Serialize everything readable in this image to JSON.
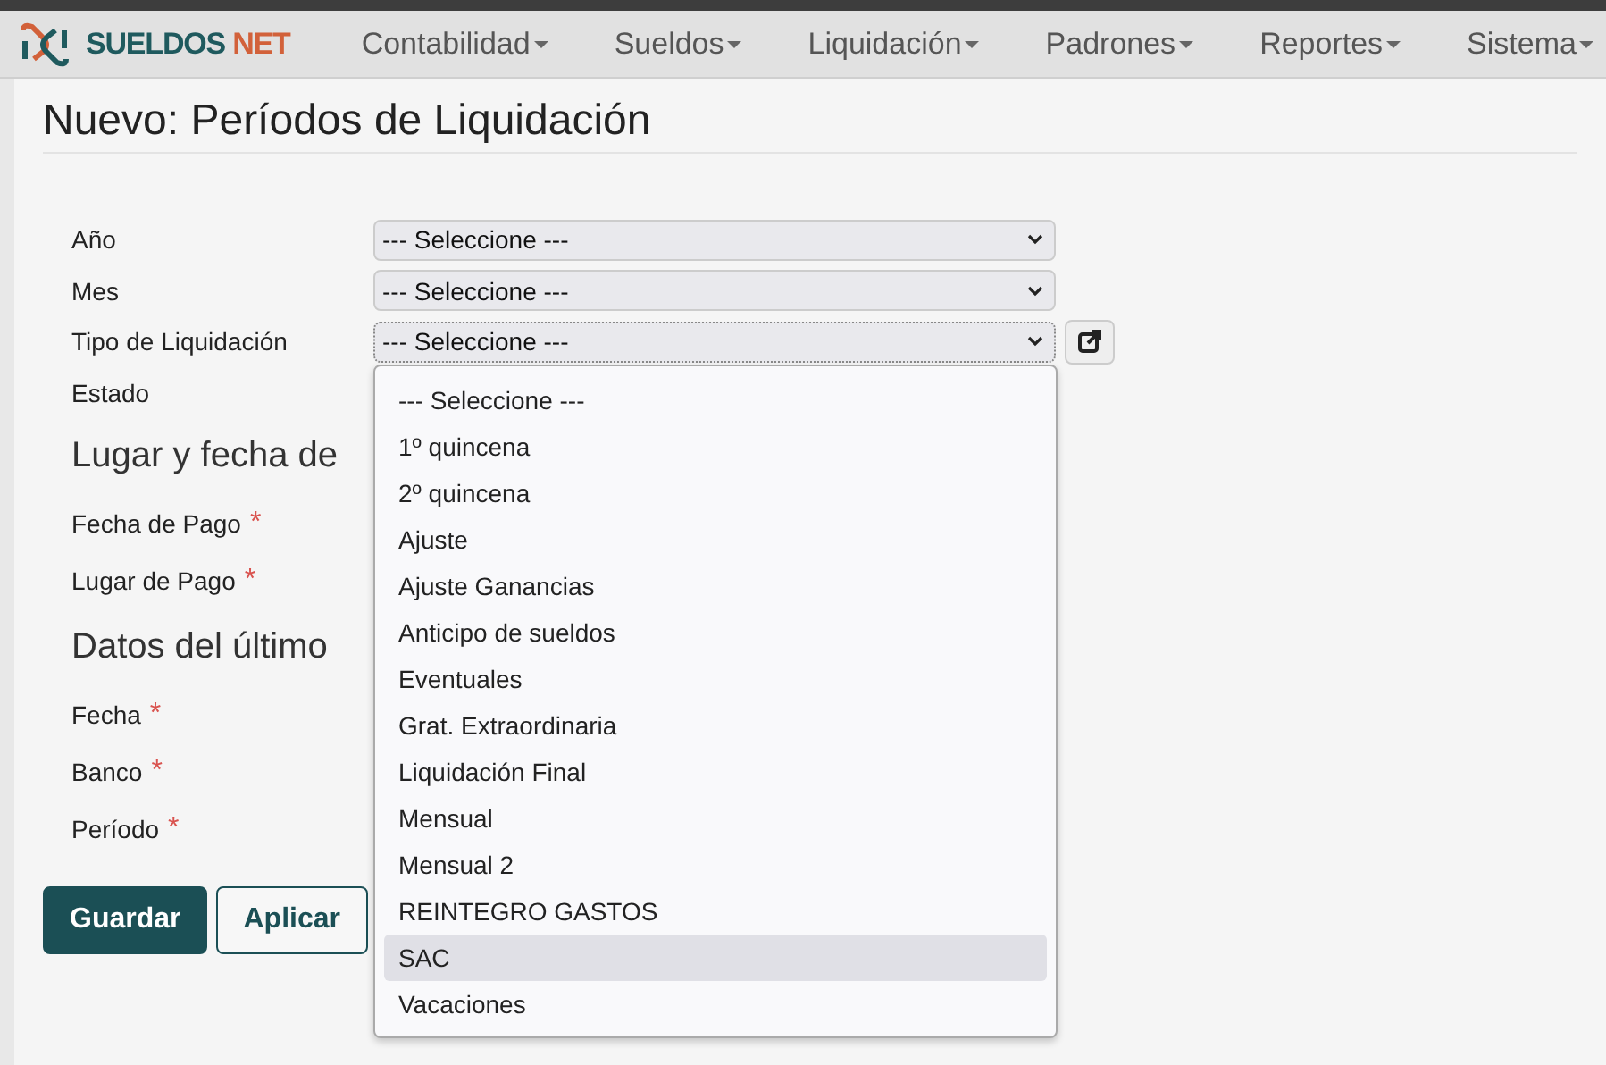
{
  "brand": {
    "name": "SUELDOS",
    "suffix": "NET"
  },
  "menu": [
    {
      "label": "Contabilidad"
    },
    {
      "label": "Sueldos"
    },
    {
      "label": "Liquidación"
    },
    {
      "label": "Padrones"
    },
    {
      "label": "Reportes"
    },
    {
      "label": "Sistema"
    }
  ],
  "title": "Nuevo: Períodos de Liquidación",
  "fields": [
    {
      "label": "Año",
      "kind": "select",
      "value": "--- Seleccione ---"
    },
    {
      "label": "Mes",
      "kind": "select",
      "value": "--- Seleccione ---"
    },
    {
      "label": "Tipo de Liquidación",
      "kind": "select-open",
      "value": "--- Seleccione ---"
    },
    {
      "label": "Estado",
      "kind": "hidden"
    }
  ],
  "sections": [
    {
      "heading": "Lugar y fecha de",
      "fields": [
        {
          "label": "Fecha de Pago",
          "required_mark": "*"
        },
        {
          "label": "Lugar de Pago",
          "required_mark": "*"
        }
      ]
    },
    {
      "heading": "Datos del último",
      "fields": [
        {
          "label": "Fecha",
          "required_mark": "*"
        },
        {
          "label": "Banco",
          "required_mark": "*"
        },
        {
          "label": "Período",
          "required_mark": "*"
        }
      ]
    }
  ],
  "dropdown": {
    "options": [
      {
        "label": "--- Seleccione ---",
        "selected": false
      },
      {
        "label": "1º quincena",
        "selected": false
      },
      {
        "label": "2º quincena",
        "selected": false
      },
      {
        "label": "Ajuste",
        "selected": false
      },
      {
        "label": "Ajuste Ganancias",
        "selected": false
      },
      {
        "label": "Anticipo de sueldos",
        "selected": false
      },
      {
        "label": "Eventuales",
        "selected": false
      },
      {
        "label": "Grat. Extraordinaria",
        "selected": false
      },
      {
        "label": "Liquidación Final",
        "selected": false
      },
      {
        "label": "Mensual",
        "selected": false
      },
      {
        "label": "Mensual 2",
        "selected": false
      },
      {
        "label": "REINTEGRO GASTOS",
        "selected": false
      },
      {
        "label": "SAC",
        "selected": true
      },
      {
        "label": "Vacaciones",
        "selected": false
      }
    ]
  },
  "buttons": [
    {
      "label": "Guardar",
      "kind": "primary"
    },
    {
      "label": "Aplicar",
      "kind": "secondary"
    }
  ]
}
